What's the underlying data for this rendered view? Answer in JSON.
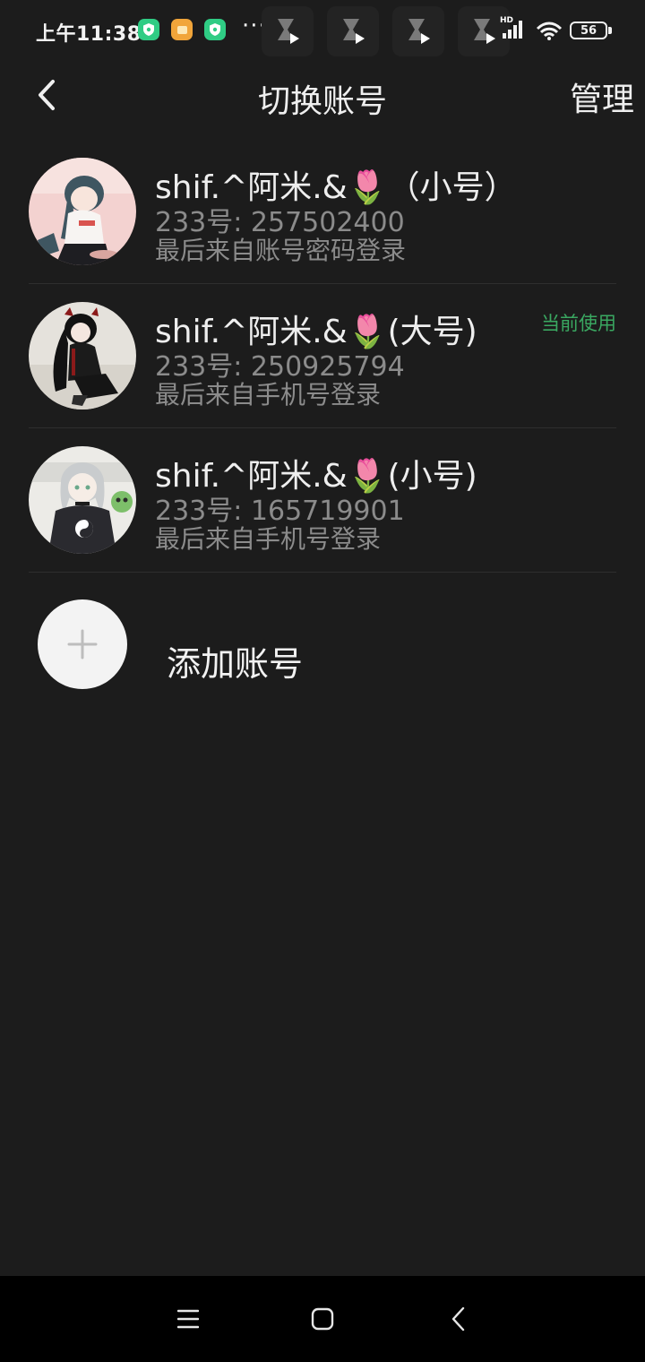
{
  "status_bar": {
    "time": "上午11:38",
    "more": "···",
    "network": "HD",
    "battery": "56"
  },
  "header": {
    "back_icon": "chevron-left-icon",
    "title": "切换账号",
    "manage": "管理"
  },
  "accounts": [
    {
      "name": "shif.^阿米.&🌷（小号）",
      "number": "233号: 257502400",
      "login": "最后来自账号密码登录",
      "current": ""
    },
    {
      "name": "shif.^阿米.&🌷(大号)",
      "number": "233号: 250925794",
      "login": "最后来自手机号登录",
      "current": "当前使用"
    },
    {
      "name": "shif.^阿米.&🌷(小号)",
      "number": "233号: 165719901",
      "login": "最后来自手机号登录",
      "current": ""
    }
  ],
  "add_account": {
    "icon": "plus-icon",
    "label": "添加账号"
  },
  "nav": {
    "menu_icon": "menu-icon",
    "home_icon": "home-icon",
    "back_icon": "back-icon"
  },
  "colors": {
    "background": "#1c1c1c",
    "current_badge": "#3aa861",
    "secondary_text": "#8b8b8b"
  }
}
